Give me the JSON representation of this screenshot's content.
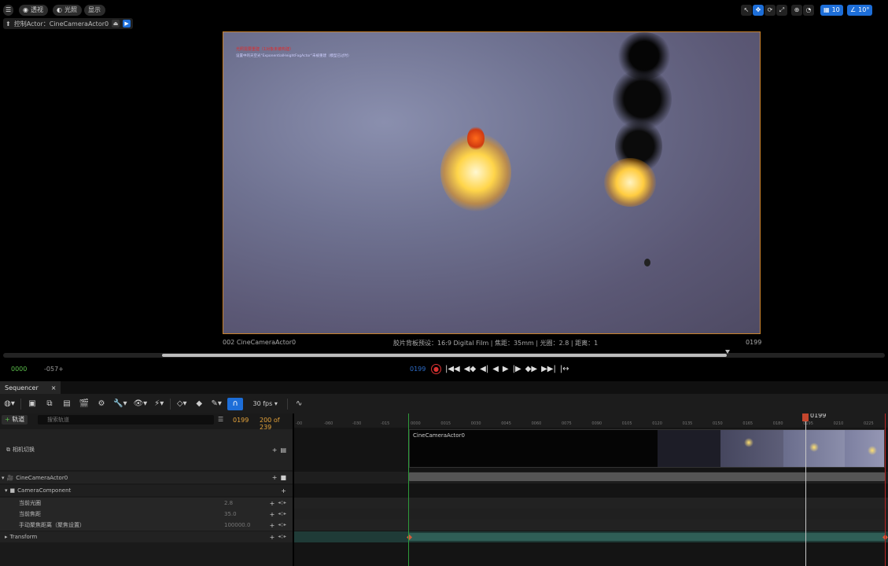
{
  "viewport": {
    "menu_icon": "menu-icon",
    "buttons": [
      {
        "label": "透视",
        "icon": "perspective-icon"
      },
      {
        "label": "光照",
        "icon": "lit-icon"
      },
      {
        "label": "显示",
        "icon": ""
      }
    ],
    "pilot": {
      "label": "控制Actor：CineCameraActor0"
    },
    "right_toolbar": {
      "grid_value": "10",
      "angle_value": "10°"
    },
    "overlay_warning_1": "光照需要重建（1对象未被构建）",
    "overlay_warning_2": "设置中的天空光\"ExponentialHeightFogActor\"未被重建（模型已过时）",
    "camera_label": "002 CineCameraActor0",
    "film_info": "胶片背板预设：16:9 Digital Film | 焦距：35mm | 光圈：2.8 | 距离：1",
    "frame_number": "0199",
    "start_time": "0000",
    "neg_time": "-057+",
    "current_time": "0199"
  },
  "sequencer": {
    "tab_label": "Sequencer",
    "close_icon": "×",
    "fps_label": "30 fps",
    "track_button": "轨道",
    "search_placeholder": "搜索轨道",
    "frame_current": "0199",
    "frame_range": "200 of 239",
    "rows": [
      {
        "label": "相机切换"
      },
      {
        "label": "CineCameraActor0"
      },
      {
        "label": "CameraComponent"
      },
      {
        "label": "当前光圈",
        "value": "2.8"
      },
      {
        "label": "当前焦距",
        "value": "35.0"
      },
      {
        "label": "手动聚焦距离（聚焦设置）",
        "value": "100000.0"
      },
      {
        "label": "Transform"
      }
    ],
    "shot_label": "CineCameraActor0",
    "playhead_label": "0199",
    "ruler_ticks": [
      "-00",
      "-060",
      "-030",
      "-015",
      "0000",
      "0015",
      "0030",
      "0045",
      "0060",
      "0075",
      "0090",
      "0105",
      "0120",
      "0135",
      "0150",
      "0165",
      "0180",
      "0195",
      "0210",
      "0225"
    ]
  }
}
